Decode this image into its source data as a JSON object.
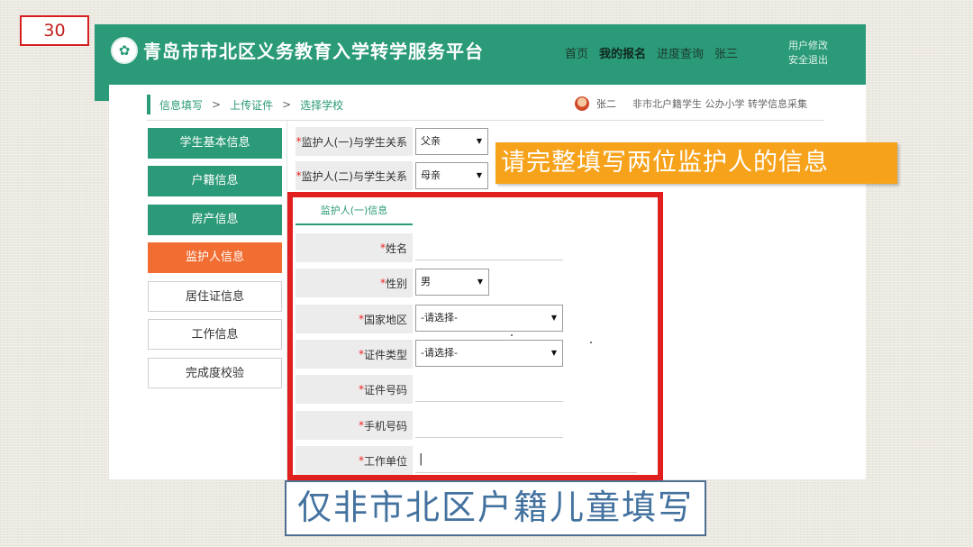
{
  "slide_number": "30",
  "header": {
    "site_title": "青岛市市北区义务教育入学转学服务平台",
    "nav": [
      "首页",
      "我的报名",
      "进度查询",
      "张三"
    ],
    "user_links": [
      "用户修改",
      "安全退出"
    ]
  },
  "breadcrumb": [
    "信息填写",
    "上传证件",
    "选择学校"
  ],
  "breadcrumb_sep": ">",
  "current_user": {
    "name": "张二",
    "description": "非市北户籍学生 公办小学 转学信息采集"
  },
  "sidebar": [
    {
      "label": "学生基本信息",
      "state": "done"
    },
    {
      "label": "户籍信息",
      "state": "done"
    },
    {
      "label": "房产信息",
      "state": "done"
    },
    {
      "label": "监护人信息",
      "state": "active"
    },
    {
      "label": "居住证信息",
      "state": "todo"
    },
    {
      "label": "工作信息",
      "state": "todo"
    },
    {
      "label": "完成度校验",
      "state": "todo"
    }
  ],
  "relations": [
    {
      "label": "监护人(一)与学生关系",
      "value": "父亲"
    },
    {
      "label": "监护人(二)与学生关系",
      "value": "母亲"
    }
  ],
  "required_mark": "*",
  "guardian_tab": "监护人(一)信息",
  "form": {
    "name_label": "姓名",
    "name_value": "",
    "gender_label": "性别",
    "gender_value": "男",
    "region_label": "国家地区",
    "region_value": "-请选择-",
    "idtype_label": "证件类型",
    "idtype_value": "-请选择-",
    "idnum_label": "证件号码",
    "idnum_value": "",
    "phone_label": "手机号码",
    "phone_value": "",
    "work_label": "工作单位",
    "work_value": "|"
  },
  "callouts": {
    "orange": "请完整填写两位监护人的信息",
    "blue": "仅非市北区户籍儿童填写"
  },
  "colors": {
    "brand_green": "#2a9a78",
    "active_orange": "#f16d31",
    "highlight_red": "#e11f1f",
    "callout_orange": "#f7a21b"
  }
}
